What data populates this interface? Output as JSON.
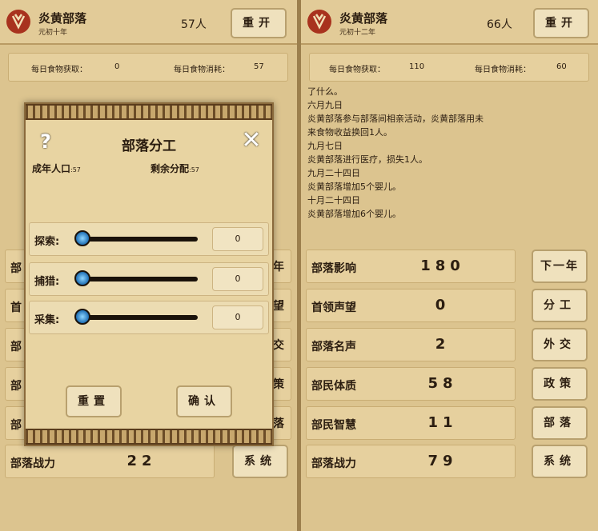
{
  "left": {
    "tribe_name": "炎黄部落",
    "era": "元初十年",
    "population": "57人",
    "restart_label": "重开",
    "food": {
      "gain_label": "每日食物获取：",
      "gain_value": "0",
      "use_label": "每日食物消耗：",
      "use_value": "57"
    },
    "hidden_rows": [
      {
        "label": "部"
      },
      {
        "label": "首"
      },
      {
        "label": "部"
      },
      {
        "label": "部"
      },
      {
        "label": "部"
      }
    ],
    "hidden_side": [
      "年",
      "望",
      "交",
      "策",
      "落"
    ],
    "battle": {
      "label": "部落战力",
      "value": "22"
    },
    "system_label": "系统"
  },
  "dialog": {
    "title": "部落分工",
    "help_icon": "question-mark-icon",
    "close_icon": "close-icon",
    "adults_label": "成年人口",
    "adults_value": ":57",
    "remain_label": "剩余分配",
    "remain_value": ":57",
    "jobs": [
      {
        "label": "探索:",
        "value": "0"
      },
      {
        "label": "捕猎:",
        "value": "0"
      },
      {
        "label": "采集:",
        "value": "0"
      }
    ],
    "reset_label": "重置",
    "confirm_label": "确认"
  },
  "right": {
    "tribe_name": "炎黄部落",
    "era": "元初十二年",
    "population": "66人",
    "restart_label": "重开",
    "food": {
      "gain_label": "每日食物获取：",
      "gain_value": "110",
      "use_label": "每日食物消耗：",
      "use_value": "60"
    },
    "log": [
      "了什么。",
      "六月九日",
      "炎黄部落参与部落间相亲活动，炎黄部落用未",
      "来食物收益换回1人。",
      "九月七日",
      "炎黄部落进行医疗，损失1人。",
      "九月二十四日",
      "炎黄部落增加5个婴儿。",
      "十月二十四日",
      "炎黄部落增加6个婴儿。"
    ],
    "stats": [
      {
        "label": "部落影响",
        "value": "180"
      },
      {
        "label": "首领声望",
        "value": "0"
      },
      {
        "label": "部落名声",
        "value": "2"
      },
      {
        "label": "部民体质",
        "value": "58"
      },
      {
        "label": "部民智慧",
        "value": "11"
      },
      {
        "label": "部落战力",
        "value": "79"
      }
    ],
    "buttons": [
      "下一年",
      "分工",
      "外交",
      "政策",
      "部落",
      "系统"
    ]
  },
  "colors": {
    "paper": "#e6d09e",
    "ink": "#2b1d10",
    "emblem": "#a8321e",
    "slider_knob": "#1f6fb4"
  }
}
